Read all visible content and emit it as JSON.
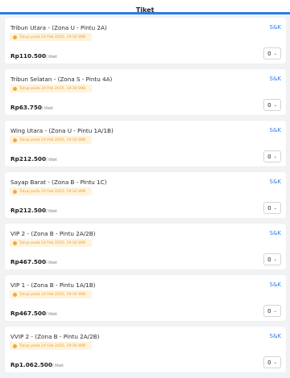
{
  "header": {
    "title": "Tiket"
  },
  "tickets": [
    {
      "name": "Tribun Utara - (Zona U - Pintu 2A)",
      "closing": "Tutup pada 24 Feb 2025, 19:30 WIB",
      "price": "Rp110.500",
      "unit": "/ tiket",
      "qty": "0",
      "sk": "S&K"
    },
    {
      "name": "Tribun Selatan - (Zona S - Pintu 4A)",
      "closing": "Tutup pada 24 Feb 2025, 19:30 WIB",
      "price": "Rp63.750",
      "unit": "/ tiket",
      "qty": "0",
      "sk": "S&K"
    },
    {
      "name": "Wing Utara - (Zona U - Pintu 1A/1B)",
      "closing": "Tutup pada 24 Feb 2025, 19:30 WIB",
      "price": "Rp212.500",
      "unit": "/ tiket",
      "qty": "0",
      "sk": "S&K"
    },
    {
      "name": "Sayap Barat - (Zona B - Pintu 1C)",
      "closing": "Tutup pada 24 Feb 2025, 19:30 WIB",
      "price": "Rp212.500",
      "unit": "/ tiket",
      "qty": "0",
      "sk": "S&K"
    },
    {
      "name": "VIP 2 - (Zona B - Pintu 2A/2B)",
      "closing": "Tutup pada 24 Feb 2025, 19:30 WIB",
      "price": "Rp467.500",
      "unit": "/ tiket",
      "qty": "0",
      "sk": "S&K"
    },
    {
      "name": "VIP 1 - (Zona B - Pintu 1A/1B)",
      "closing": "Tutup pada 24 Feb 2025, 19:30 WIB",
      "price": "Rp467.500",
      "unit": "/ tiket",
      "qty": "0",
      "sk": "S&K"
    },
    {
      "name": "VVIP 2 - (Zona B - Pintu 2A/2B)",
      "closing": "Tutup pada 24 Feb 2025, 19:30 WIB",
      "price": "Rp1.062.500",
      "unit": "/ tiket",
      "qty": "0",
      "sk": "S&K"
    }
  ],
  "icons": {
    "closing": "clock-icon",
    "qty": "chevron-down-icon"
  },
  "colors": {
    "accent": "#2f7be5",
    "warning": "#f2a93b",
    "warning_bg": "#fff3dc"
  }
}
